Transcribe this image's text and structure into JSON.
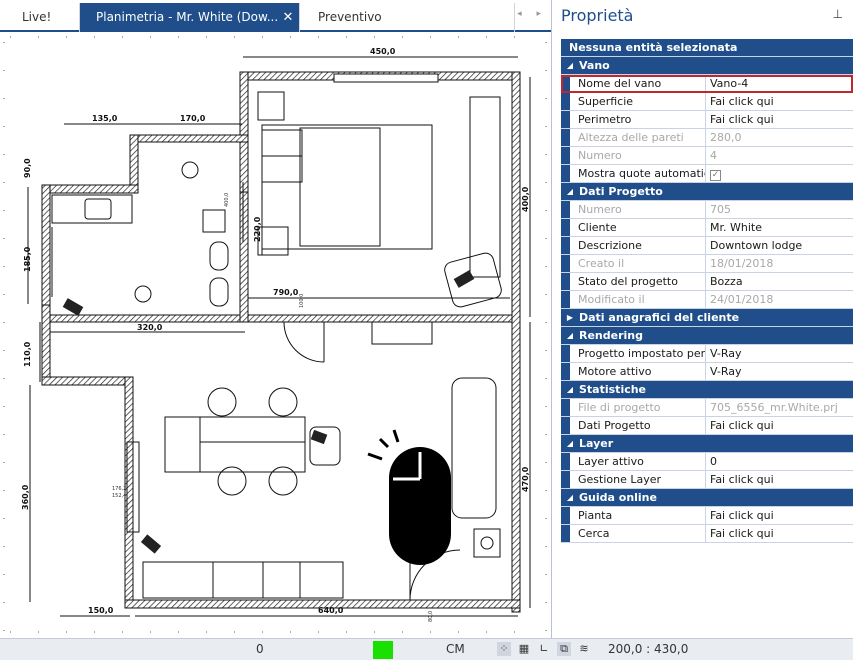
{
  "tabs": [
    {
      "label": "Live!"
    },
    {
      "label": "Planimetria - Mr. White (Dow..."
    },
    {
      "label": "Preventivo"
    }
  ],
  "tab_close_glyph": "✕",
  "tab_nav_glyph": "◂ ▸",
  "plan": {
    "dims": [
      "450,0",
      "135,0",
      "170,0",
      "90,0",
      "185,0",
      "400,0",
      "220,0",
      "790,0",
      "320,0",
      "110,0",
      "360,0",
      "470,0",
      "150,0",
      "640,0"
    ],
    "small": [
      "100,0",
      "176,2",
      "152,4",
      "80,0"
    ]
  },
  "properties": {
    "title": "Proprietà",
    "pin_glyph": "⊥",
    "selection_header": "Nessuna entità selezionata",
    "sections": [
      {
        "name": "Vano",
        "expanded": true,
        "rows": [
          {
            "key": "Nome del vano",
            "value": "Vano-4",
            "selected": true
          },
          {
            "key": "Superficie",
            "value": "Fai click qui"
          },
          {
            "key": "Perimetro",
            "value": "Fai click qui"
          },
          {
            "key": "Altezza delle pareti",
            "value": "280,0",
            "disabled": true
          },
          {
            "key": "Numero",
            "value": "4",
            "disabled": true
          },
          {
            "key": "Mostra quote automatiche",
            "value": "",
            "checkbox": true
          }
        ]
      },
      {
        "name": "Dati Progetto",
        "expanded": true,
        "rows": [
          {
            "key": "Numero",
            "value": "705",
            "disabled": true
          },
          {
            "key": "Cliente",
            "value": "Mr. White"
          },
          {
            "key": "Descrizione",
            "value": "Downtown lodge"
          },
          {
            "key": "Creato il",
            "value": "18/01/2018",
            "disabled": true
          },
          {
            "key": "Stato del progetto",
            "value": "Bozza"
          },
          {
            "key": "Modificato il",
            "value": "24/01/2018",
            "disabled": true
          }
        ]
      },
      {
        "name": "Dati anagrafici del cliente",
        "expanded": false,
        "rows": []
      },
      {
        "name": "Rendering",
        "expanded": true,
        "rows": [
          {
            "key": "Progetto impostato per",
            "value": "V-Ray"
          },
          {
            "key": "Motore attivo",
            "value": "V-Ray"
          }
        ]
      },
      {
        "name": "Statistiche",
        "expanded": true,
        "rows": [
          {
            "key": "File di progetto",
            "value": "705_6556_mr.White.prj",
            "disabled": true
          },
          {
            "key": "Dati Progetto",
            "value": "Fai click qui"
          }
        ]
      },
      {
        "name": "Layer",
        "expanded": true,
        "rows": [
          {
            "key": "Layer attivo",
            "value": "0"
          },
          {
            "key": "Gestione Layer",
            "value": "Fai click qui"
          }
        ]
      },
      {
        "name": "Guida online",
        "expanded": true,
        "rows": [
          {
            "key": "Pianta",
            "value": "Fai click qui"
          },
          {
            "key": "Cerca",
            "value": "Fai click qui"
          }
        ]
      }
    ]
  },
  "status": {
    "left_value": "0",
    "unit": "CM",
    "coords": "200,0 : 430,0",
    "indicator_color": "#19e000",
    "icons": [
      "snap-grid-icon",
      "grid-icon",
      "ortho-icon",
      "layers-icon",
      "wifi-icon"
    ]
  },
  "colors": {
    "accent": "#1f4e8a",
    "selection": "#c0262d"
  }
}
